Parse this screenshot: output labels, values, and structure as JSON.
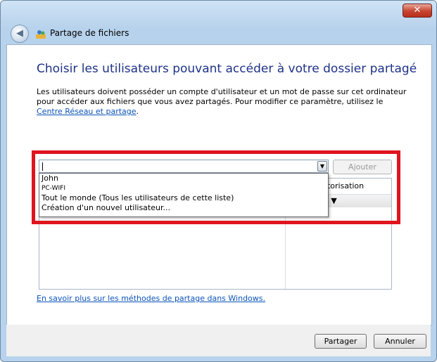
{
  "window": {
    "title": "Partage de fichiers",
    "close_glyph": "✕",
    "back_glyph": "◀",
    "icons": {
      "back": "back-arrow-icon",
      "app": "file-sharing-users-icon",
      "close": "close-icon",
      "dropdown": "chevron-down-icon"
    }
  },
  "main": {
    "heading": "Choisir les utilisateurs pouvant accéder à votre dossier partagé",
    "description": "Les utilisateurs doivent posséder un compte d'utilisateur et un mot de passe sur cet ordinateur pour accéder aux fichiers que vous avez partagés. Pour modifier ce paramètre, utilisez le ",
    "link_text": "Centre Réseau et partage",
    "description_end": "."
  },
  "user_combo": {
    "value": "",
    "dropdown_glyph": "▼",
    "add_label": "Ajouter",
    "options": [
      "John",
      "PC-WIFI",
      "Tout le monde (Tous les utilisateurs de cette liste)",
      "Création d'un nouvel utilisateur..."
    ]
  },
  "list": {
    "column_permission": "utorisation",
    "row_value": "e ▼"
  },
  "learn_more": "En savoir plus sur les méthodes de partage dans Windows.",
  "footer": {
    "share_label": "Partager",
    "cancel_label": "Annuler"
  },
  "colors": {
    "highlight_border": "#e0141e",
    "heading": "#1e3287",
    "link": "#0a53b8"
  }
}
